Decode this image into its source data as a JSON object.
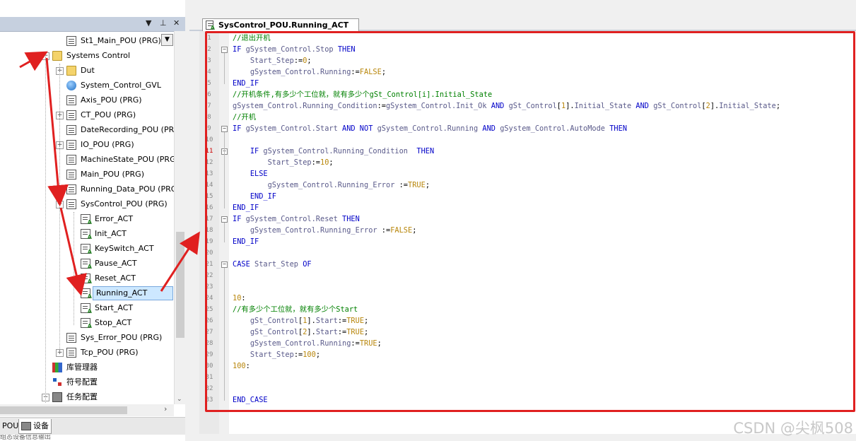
{
  "tree": {
    "items": [
      {
        "label": "St1_Main_POU (PRG)",
        "icon": "pou-icon"
      },
      {
        "label": "Systems Control",
        "icon": "folder-icon"
      },
      {
        "label": "Dut",
        "icon": "folder-icon"
      },
      {
        "label": "System_Control_GVL",
        "icon": "globe-icon"
      },
      {
        "label": "Axis_POU (PRG)",
        "icon": "pou-icon"
      },
      {
        "label": "CT_POU (PRG)",
        "icon": "pou-icon"
      },
      {
        "label": "DateRecording_POU (PRG)",
        "icon": "pou-icon"
      },
      {
        "label": "IO_POU (PRG)",
        "icon": "pou-icon"
      },
      {
        "label": "MachineState_POU (PRG)",
        "icon": "pou-icon"
      },
      {
        "label": "Main_POU (PRG)",
        "icon": "pou-icon"
      },
      {
        "label": "Running_Data_POU (PRG)",
        "icon": "pou-icon"
      },
      {
        "label": "SysControl_POU (PRG)",
        "icon": "pou-icon"
      },
      {
        "label": "Error_ACT",
        "icon": "action-icon"
      },
      {
        "label": "Init_ACT",
        "icon": "action-icon"
      },
      {
        "label": "KeySwitch_ACT",
        "icon": "action-icon"
      },
      {
        "label": "Pause_ACT",
        "icon": "action-icon"
      },
      {
        "label": "Reset_ACT",
        "icon": "action-icon"
      },
      {
        "label": "Running_ACT",
        "icon": "action-icon",
        "selected": true
      },
      {
        "label": "Start_ACT",
        "icon": "action-icon"
      },
      {
        "label": "Stop_ACT",
        "icon": "action-icon"
      },
      {
        "label": "Sys_Error_POU (PRG)",
        "icon": "pou-icon"
      },
      {
        "label": "Tcp_POU (PRG)",
        "icon": "pou-icon"
      },
      {
        "label": "库管理器",
        "icon": "library-icon"
      },
      {
        "label": "符号配置",
        "icon": "symbol-icon"
      },
      {
        "label": "任务配置",
        "icon": "task-icon"
      }
    ]
  },
  "panel_controls": {
    "dropdown": "▼",
    "pin": "ᵖ",
    "close": "✕"
  },
  "bottom_tabs": {
    "pous": "POUs",
    "devices": "设备"
  },
  "status_text": "组态设备信息输出",
  "editor": {
    "tab_title": "SysControl_POU.Running_ACT",
    "lines": [
      {
        "n": "1",
        "html": "<span class='cm'>//退出开机</span>"
      },
      {
        "n": "2",
        "html": "<span class='kw'>IF</span> <span class='va'>gSystem_Control.Stop</span> <span class='kw'>THEN</span>"
      },
      {
        "n": "3",
        "html": "    <span class='va'>Start_Step</span>:=<span class='lt'>0</span>;"
      },
      {
        "n": "4",
        "html": "    <span class='va'>gSystem_Control.Running</span>:=<span class='lt'>FALSE</span>;"
      },
      {
        "n": "5",
        "html": "<span class='kw'>END_IF</span>"
      },
      {
        "n": "6",
        "html": "<span class='cm'>//开机条件,有多少个工位就，就有多少个gSt_Control[i].Initial_State</span>"
      },
      {
        "n": "7",
        "html": "<span class='va'>gSystem_Control.Running_Condition</span>:=<span class='va'>gSystem_Control.Init_Ok</span> <span class='kw'>AND</span> <span class='va'>gSt_Control</span>[<span class='lt'>1</span>].<span class='va'>Initial_State</span> <span class='kw'>AND</span> <span class='va'>gSt_Control</span>[<span class='lt'>2</span>].<span class='va'>Initial_State</span>;"
      },
      {
        "n": "8",
        "html": "<span class='cm'>//开机</span>"
      },
      {
        "n": "9",
        "html": "<span class='kw'>IF</span> <span class='va'>gSystem_Control.Start</span> <span class='kw'>AND NOT</span> <span class='va'>gSystem_Control.Running</span> <span class='kw'>AND</span> <span class='va'>gSystem_Control.AutoMode</span> <span class='kw'>THEN</span>"
      },
      {
        "n": "10",
        "html": ""
      },
      {
        "n": "11",
        "html": "    <span class='kw'>IF</span> <span class='va'>gSystem_Control.Running_Condition</span>  <span class='kw'>THEN</span>"
      },
      {
        "n": "12",
        "html": "        <span class='va'>Start_Step</span>:=<span class='lt'>10</span>;"
      },
      {
        "n": "13",
        "html": "    <span class='kw'>ELSE</span>"
      },
      {
        "n": "14",
        "html": "        <span class='va'>gSystem_Control.Running_Error</span> :=<span class='lt'>TRUE</span>;"
      },
      {
        "n": "15",
        "html": "    <span class='kw'>END_IF</span>"
      },
      {
        "n": "16",
        "html": "<span class='kw'>END_IF</span>"
      },
      {
        "n": "17",
        "html": "<span class='kw'>IF</span> <span class='va'>gSystem_Control.Reset</span> <span class='kw'>THEN</span>"
      },
      {
        "n": "18",
        "html": "    <span class='va'>gSystem_Control.Running_Error</span> :=<span class='lt'>FALSE</span>;"
      },
      {
        "n": "19",
        "html": "<span class='kw'>END_IF</span>"
      },
      {
        "n": "20",
        "html": ""
      },
      {
        "n": "21",
        "html": "<span class='kw'>CASE</span> <span class='va'>Start_Step</span> <span class='kw'>OF</span>"
      },
      {
        "n": "22",
        "html": ""
      },
      {
        "n": "23",
        "html": ""
      },
      {
        "n": "24",
        "html": "<span class='lt'>10</span>:"
      },
      {
        "n": "25",
        "html": "<span class='cm'>//有多少个工位就，就有多少个Start</span>"
      },
      {
        "n": "26",
        "html": "    <span class='va'>gSt_Control</span>[<span class='lt'>1</span>].<span class='va'>Start</span>:=<span class='lt'>TRUE</span>;"
      },
      {
        "n": "27",
        "html": "    <span class='va'>gSt_Control</span>[<span class='lt'>2</span>].<span class='va'>Start</span>:=<span class='lt'>TRUE</span>;"
      },
      {
        "n": "28",
        "html": "    <span class='va'>gSystem_Control.Running</span>:=<span class='lt'>TRUE</span>;"
      },
      {
        "n": "29",
        "html": "    <span class='va'>Start_Step</span>:=<span class='lt'>100</span>;"
      },
      {
        "n": "30",
        "html": "<span class='lt'>100</span>:"
      },
      {
        "n": "31",
        "html": ""
      },
      {
        "n": "32",
        "html": ""
      },
      {
        "n": "33",
        "html": "<span class='kw'>END_CASE</span>"
      }
    ]
  },
  "watermark": "CSDN @尖枫508",
  "colors": {
    "annotation_red": "#e02020",
    "selection": "#cde8ff",
    "keyword": "#0000c8",
    "comment": "#008000"
  }
}
